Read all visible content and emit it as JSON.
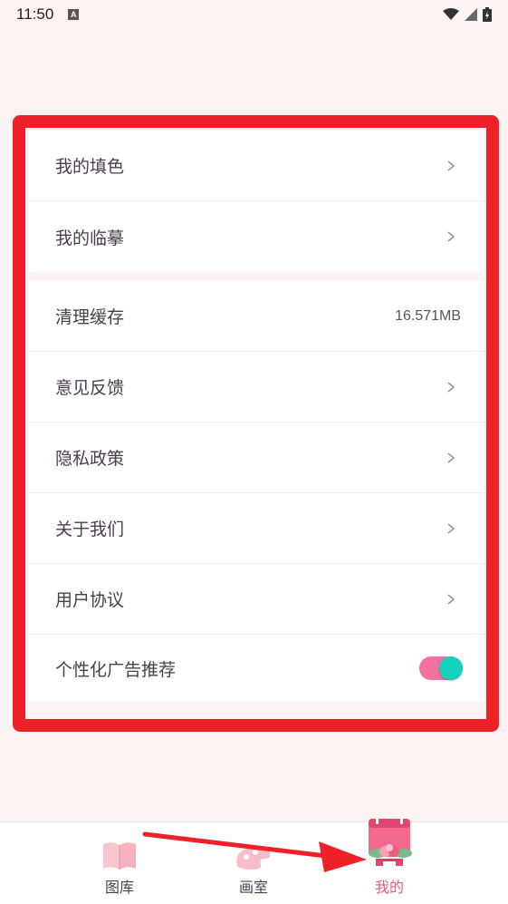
{
  "status_bar": {
    "time": "11:50",
    "notification_icon": "a-letter-icon",
    "icons": [
      "wifi-icon",
      "signal-icon",
      "battery-charging-icon"
    ]
  },
  "settings": {
    "group1": [
      {
        "label": "我的填色",
        "icon": "chevron-right-icon"
      },
      {
        "label": "我的临摹",
        "icon": "chevron-right-icon"
      }
    ],
    "group2": [
      {
        "label": "清理缓存",
        "value": "16.571MB"
      },
      {
        "label": "意见反馈",
        "icon": "chevron-right-icon"
      },
      {
        "label": "隐私政策",
        "icon": "chevron-right-icon"
      },
      {
        "label": "关于我们",
        "icon": "chevron-right-icon"
      },
      {
        "label": "用户协议",
        "icon": "chevron-right-icon"
      },
      {
        "label": "个性化广告推荐",
        "toggle_on": true
      }
    ]
  },
  "tabbar": {
    "tabs": [
      {
        "label": "图库",
        "icon": "book-icon",
        "active": false
      },
      {
        "label": "画室",
        "icon": "palette-icon",
        "active": false
      },
      {
        "label": "我的",
        "icon": "calendar-flower-icon",
        "active": true
      }
    ]
  },
  "colors": {
    "highlight": "#ee2028",
    "accent": "#ee5a7b",
    "toggle_track": "#f471a0",
    "toggle_knob": "#13d3bd",
    "background": "#fdf3f2"
  }
}
